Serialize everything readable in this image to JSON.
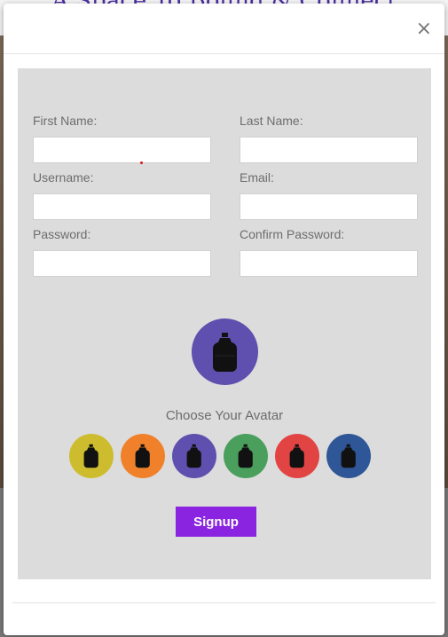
{
  "background": {
    "title": "A Space To Bound & Connect"
  },
  "modal": {
    "close_label": "×",
    "fields": {
      "first_name": {
        "label": "First Name:",
        "value": ""
      },
      "last_name": {
        "label": "Last Name:",
        "value": ""
      },
      "username": {
        "label": "Username:",
        "value": ""
      },
      "email": {
        "label": "Email:",
        "value": ""
      },
      "password": {
        "label": "Password:",
        "value": ""
      },
      "confirm_password": {
        "label": "Confirm Password:",
        "value": ""
      }
    },
    "selected_avatar": {
      "color": "#5f4fae",
      "icon": "bottle-icon"
    },
    "choose_title": "Choose Your Avatar",
    "avatars": [
      {
        "color": "#cdbd2e",
        "icon": "bottle-icon"
      },
      {
        "color": "#f0812a",
        "icon": "bottle-icon"
      },
      {
        "color": "#5f4fae",
        "icon": "bottle-icon"
      },
      {
        "color": "#4a9f5c",
        "icon": "bottle-icon"
      },
      {
        "color": "#e24444",
        "icon": "bottle-icon"
      },
      {
        "color": "#2f5697",
        "icon": "bottle-icon"
      }
    ],
    "signup_label": "Signup"
  },
  "colors": {
    "panel": "#dcdcdc",
    "accent": "#8a24e0"
  }
}
